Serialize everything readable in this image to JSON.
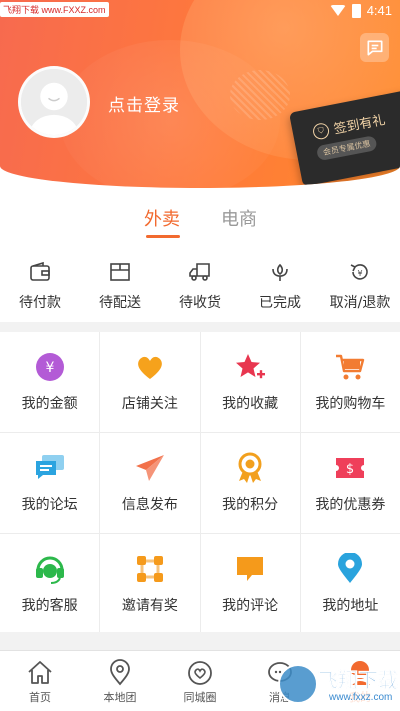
{
  "status_bar": {
    "watermark": "飞翔下载 www.FXXZ.com",
    "time": "4:41"
  },
  "header": {
    "login_text": "点击登录",
    "signin_title": "签到有礼",
    "signin_subtitle": "会员专属优惠",
    "accent": "#ff7a3a"
  },
  "tabs": [
    {
      "label": "外卖",
      "active": true
    },
    {
      "label": "电商",
      "active": false
    }
  ],
  "orders": [
    {
      "label": "待付款",
      "icon": "wallet-icon"
    },
    {
      "label": "待配送",
      "icon": "package-icon"
    },
    {
      "label": "待收货",
      "icon": "truck-icon"
    },
    {
      "label": "已完成",
      "icon": "flower-icon"
    },
    {
      "label": "取消/退款",
      "icon": "refund-icon"
    }
  ],
  "grid": [
    {
      "label": "我的金额",
      "icon": "yuan-coin-icon",
      "color": "#b35bd6"
    },
    {
      "label": "店铺关注",
      "icon": "heart-icon",
      "color": "#f6a21c"
    },
    {
      "label": "我的收藏",
      "icon": "star-plus-icon",
      "color": "#e8364f"
    },
    {
      "label": "我的购物车",
      "icon": "cart-icon",
      "color": "#f27c32"
    },
    {
      "label": "我的论坛",
      "icon": "chat-bubbles-icon",
      "color": "#2ba4e0"
    },
    {
      "label": "信息发布",
      "icon": "paper-plane-icon",
      "color": "#f2714a"
    },
    {
      "label": "我的积分",
      "icon": "medal-icon",
      "color": "#f2a01e"
    },
    {
      "label": "我的优惠券",
      "icon": "coupon-icon",
      "color": "#ef3f5a"
    },
    {
      "label": "我的客服",
      "icon": "headset-icon",
      "color": "#2cb84b"
    },
    {
      "label": "邀请有奖",
      "icon": "nodes-icon",
      "color": "#f59a1b"
    },
    {
      "label": "我的评论",
      "icon": "comment-icon",
      "color": "#f59a1b"
    },
    {
      "label": "我的地址",
      "icon": "location-pin-icon",
      "color": "#2aa3dd"
    }
  ],
  "bottom_nav": [
    {
      "label": "首页",
      "icon": "home-icon",
      "active": false
    },
    {
      "label": "本地团",
      "icon": "map-pin-icon",
      "active": false
    },
    {
      "label": "同城圈",
      "icon": "heart-circle-icon",
      "active": false
    },
    {
      "label": "消息",
      "icon": "message-icon",
      "active": false
    },
    {
      "label": "我的",
      "icon": "user-icon",
      "active": true
    }
  ],
  "watermark_br": {
    "title": "飞翔下载",
    "url": "www.fxxz.com"
  }
}
